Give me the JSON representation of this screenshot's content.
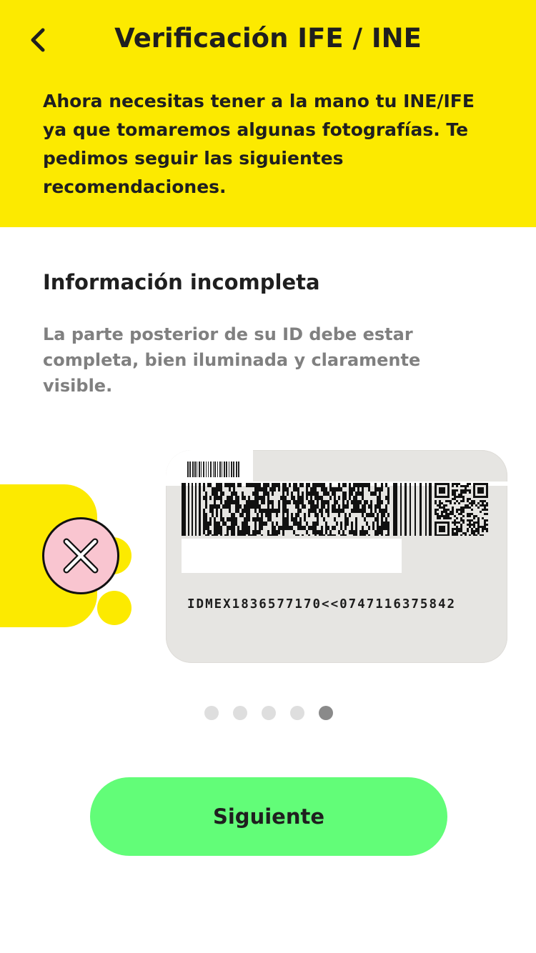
{
  "header": {
    "title": "Verificación IFE / INE",
    "back_icon": "chevron-left-icon",
    "intro": "Ahora necesitas tener a la mano tu INE/IFE ya que tomaremos algunas fotografías. Te pedimos seguir las siguientes recomendaciones."
  },
  "tip": {
    "title": "Información incompleta",
    "description": "La parte posterior de su ID debe estar completa, bien iluminada y claramente visible."
  },
  "illustration": {
    "status_icon": "close-x-icon",
    "card_mrz": "IDMEX1836577170<<0747116375842"
  },
  "pagination": {
    "total": 5,
    "active_index": 4
  },
  "footer": {
    "next_label": "Siguiente"
  },
  "colors": {
    "header_bg": "#fcea00",
    "button_bg": "#62fd78",
    "error_badge": "#f9c5d0",
    "dot_inactive": "#dedede",
    "dot_active": "#8a8a8a"
  }
}
